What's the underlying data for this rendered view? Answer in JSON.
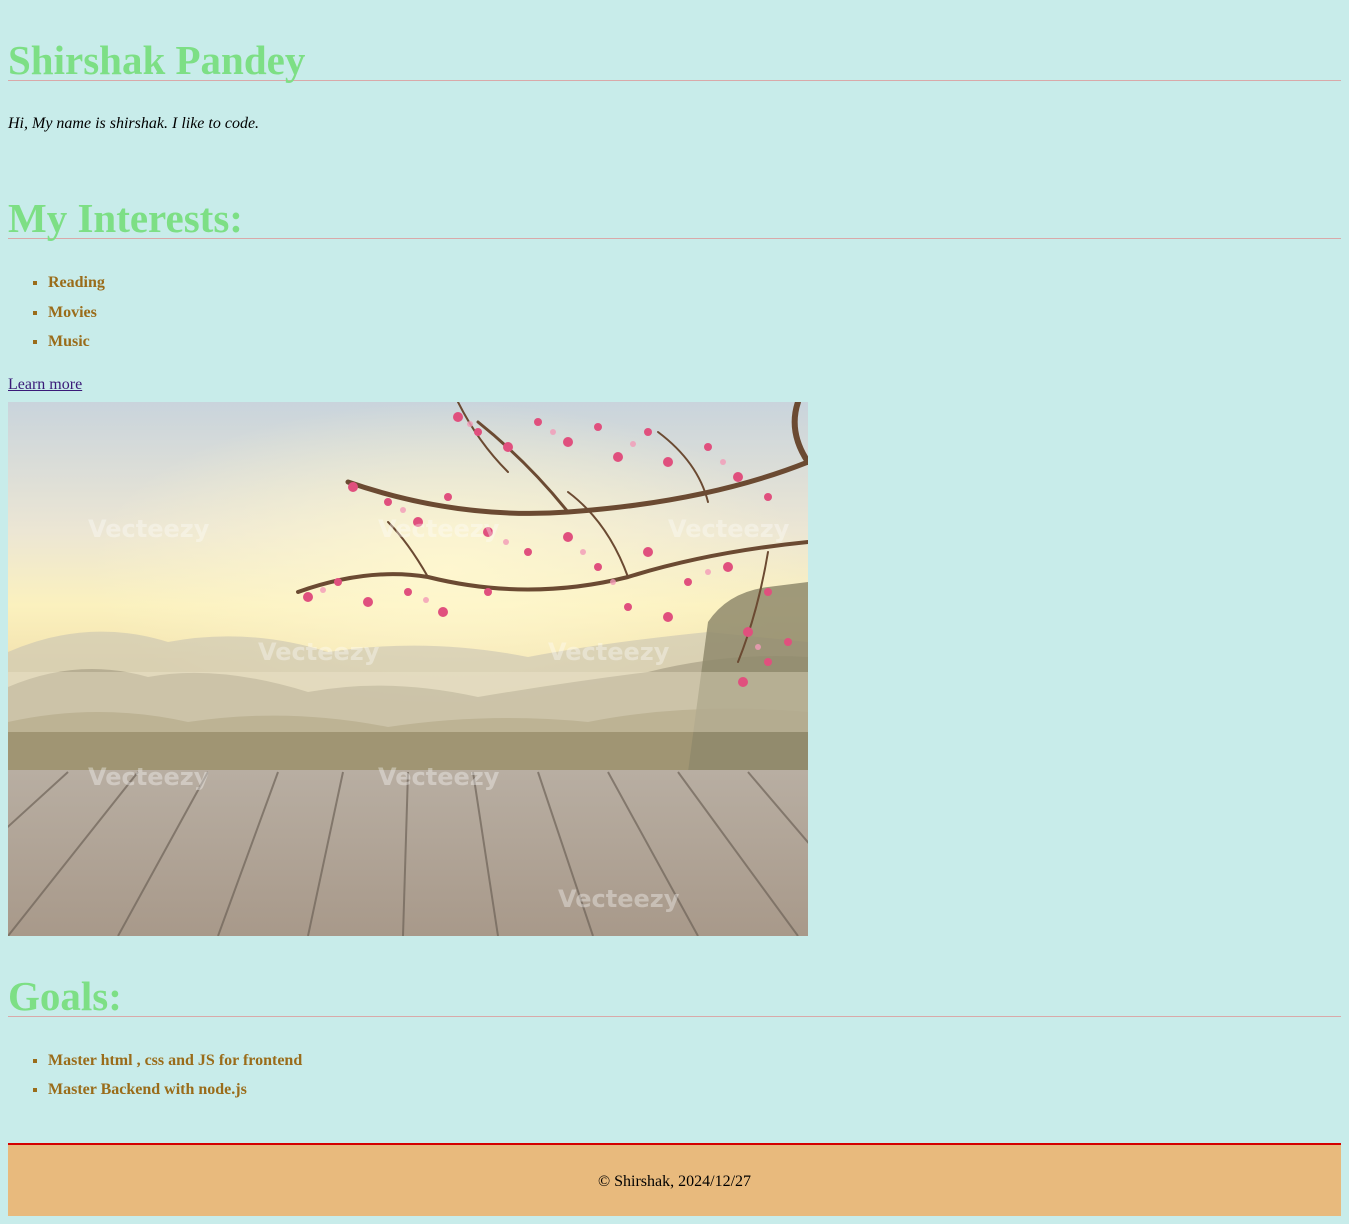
{
  "header": {
    "name": "Shirshak Pandey",
    "intro": "Hi, My name is shirshak. I like to code."
  },
  "interests": {
    "title": "My Interests:",
    "items": [
      "Reading",
      "Movies",
      "Music"
    ],
    "link_label": "Learn more"
  },
  "image": {
    "watermark": "Vecteezy"
  },
  "goals": {
    "title": "Goals:",
    "items": [
      "Master html , css and JS for frontend",
      "Master Backend with node.js"
    ]
  },
  "footer": {
    "text": "© Shirshak, 2024/12/27"
  },
  "colors": {
    "background": "#c8ecea",
    "heading": "#7ddf85",
    "list_text": "#9a6c1a",
    "footer_bg": "#e8ba7d",
    "footer_border": "#d40000"
  }
}
